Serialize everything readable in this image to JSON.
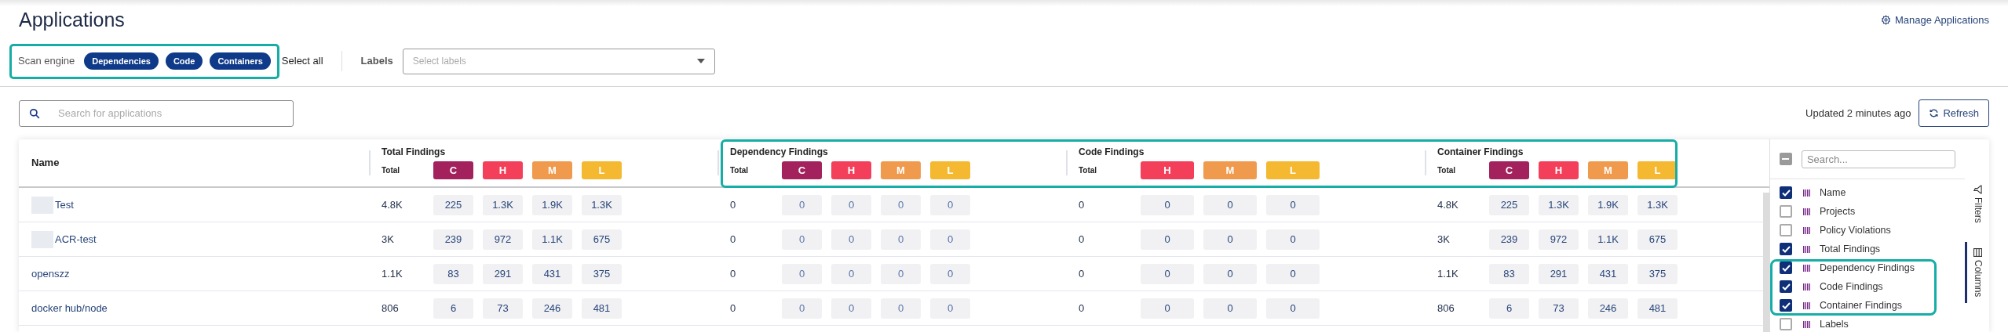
{
  "page": {
    "title": "Applications",
    "manage_link": "Manage Applications"
  },
  "filters": {
    "scan_engine_label": "Scan engine",
    "engines": [
      {
        "label": "Dependencies",
        "selected": true
      },
      {
        "label": "Code",
        "selected": true
      },
      {
        "label": "Containers",
        "selected": true
      }
    ],
    "select_all": "Select all",
    "labels_label": "Labels",
    "labels_placeholder": "Select labels"
  },
  "search": {
    "placeholder": "Search for applications"
  },
  "updated": "Updated 2 minutes ago",
  "refresh": "Refresh",
  "table": {
    "name_column": "Name",
    "groups": [
      {
        "title": "Total Findings",
        "total_label": "Total",
        "severities": [
          {
            "label": "C",
            "color": "#a3215c"
          },
          {
            "label": "H",
            "color": "#f43f5a"
          },
          {
            "label": "M",
            "color": "#f09a4e"
          },
          {
            "label": "L",
            "color": "#f5b931"
          }
        ]
      },
      {
        "title": "Dependency Findings",
        "total_label": "Total",
        "severities": [
          {
            "label": "C",
            "color": "#a3215c"
          },
          {
            "label": "H",
            "color": "#f43f5a"
          },
          {
            "label": "M",
            "color": "#f09a4e"
          },
          {
            "label": "L",
            "color": "#f5b931"
          }
        ]
      },
      {
        "title": "Code Findings",
        "total_label": "Total",
        "severities": [
          {
            "label": "H",
            "color": "#f43f5a"
          },
          {
            "label": "M",
            "color": "#f09a4e"
          },
          {
            "label": "L",
            "color": "#f5b931"
          }
        ]
      },
      {
        "title": "Container Findings",
        "total_label": "Total",
        "severities": [
          {
            "label": "C",
            "color": "#a3215c"
          },
          {
            "label": "H",
            "color": "#f43f5a"
          },
          {
            "label": "M",
            "color": "#f09a4e"
          },
          {
            "label": "L",
            "color": "#f5b931"
          }
        ]
      }
    ],
    "rows": [
      {
        "name": "Test",
        "redacted": true,
        "groups": [
          {
            "total": "4.8K",
            "counts": [
              "225",
              "1.3K",
              "1.9K",
              "1.3K"
            ]
          },
          {
            "total": "0",
            "counts": [
              "0",
              "0",
              "0",
              "0"
            ]
          },
          {
            "total": "0",
            "counts": [
              "0",
              "0",
              "0"
            ]
          },
          {
            "total": "4.8K",
            "counts": [
              "225",
              "1.3K",
              "1.9K",
              "1.3K"
            ]
          }
        ]
      },
      {
        "name": "ACR-test",
        "redacted": true,
        "groups": [
          {
            "total": "3K",
            "counts": [
              "239",
              "972",
              "1.1K",
              "675"
            ]
          },
          {
            "total": "0",
            "counts": [
              "0",
              "0",
              "0",
              "0"
            ]
          },
          {
            "total": "0",
            "counts": [
              "0",
              "0",
              "0"
            ]
          },
          {
            "total": "3K",
            "counts": [
              "239",
              "972",
              "1.1K",
              "675"
            ]
          }
        ]
      },
      {
        "name": "openszz",
        "redacted": false,
        "groups": [
          {
            "total": "1.1K",
            "counts": [
              "83",
              "291",
              "431",
              "375"
            ]
          },
          {
            "total": "0",
            "counts": [
              "0",
              "0",
              "0",
              "0"
            ]
          },
          {
            "total": "0",
            "counts": [
              "0",
              "0",
              "0"
            ]
          },
          {
            "total": "1.1K",
            "counts": [
              "83",
              "291",
              "431",
              "375"
            ]
          }
        ]
      },
      {
        "name": "docker hub/node",
        "redacted": false,
        "groups": [
          {
            "total": "806",
            "counts": [
              "6",
              "73",
              "246",
              "481"
            ]
          },
          {
            "total": "0",
            "counts": [
              "0",
              "0",
              "0",
              "0"
            ]
          },
          {
            "total": "0",
            "counts": [
              "0",
              "0",
              "0"
            ]
          },
          {
            "total": "806",
            "counts": [
              "6",
              "73",
              "246",
              "481"
            ]
          }
        ]
      }
    ]
  },
  "column_panel": {
    "select_all": {
      "indeterminate": true
    },
    "search_placeholder": "Search...",
    "columns": [
      {
        "label": "Name",
        "checked": true
      },
      {
        "label": "Projects",
        "checked": false
      },
      {
        "label": "Policy Violations",
        "checked": false
      },
      {
        "label": "Total Findings",
        "checked": true
      },
      {
        "label": "Dependency Findings",
        "checked": true
      },
      {
        "label": "Code Findings",
        "checked": true
      },
      {
        "label": "Container Findings",
        "checked": true
      },
      {
        "label": "Labels",
        "checked": false
      }
    ]
  },
  "side_tabs": [
    {
      "label": "Filters",
      "kind": "filters",
      "selected": false
    },
    {
      "label": "Columns",
      "kind": "columns",
      "selected": true
    }
  ]
}
